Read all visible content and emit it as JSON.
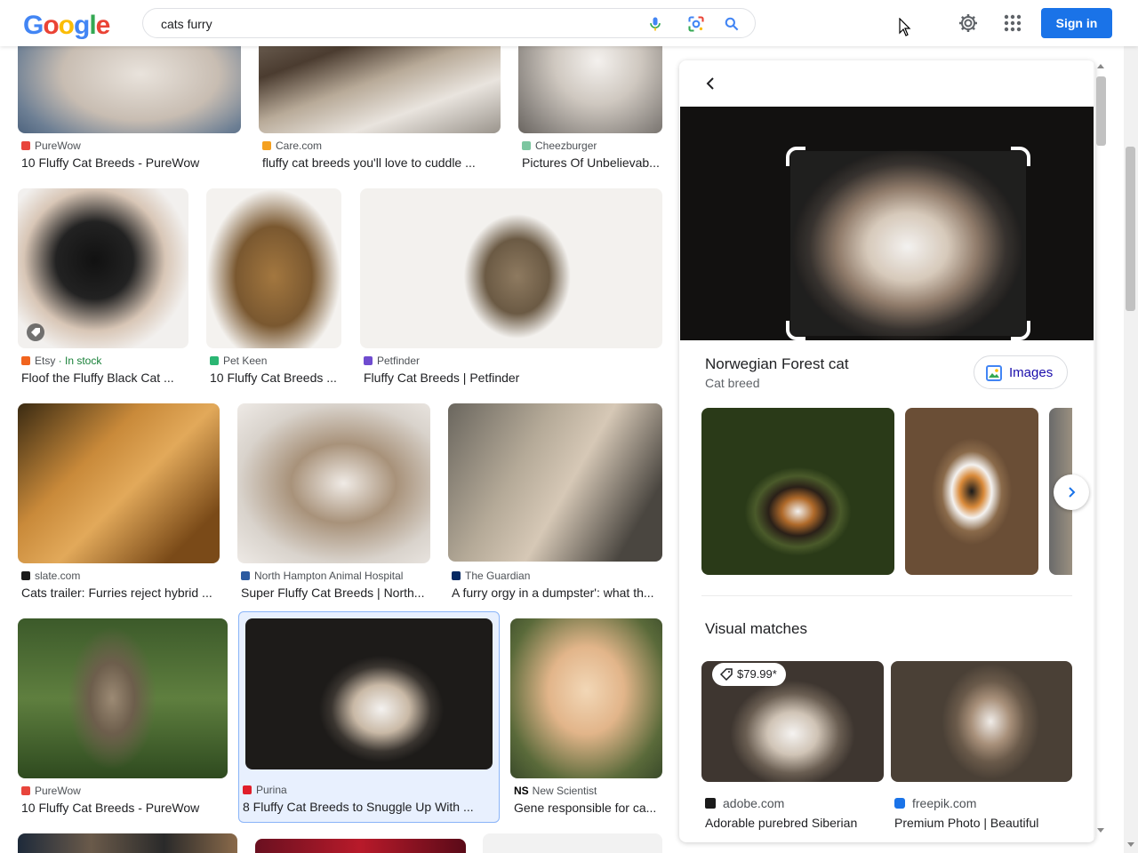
{
  "header": {
    "logo": [
      "G",
      "o",
      "o",
      "g",
      "l",
      "e"
    ],
    "logo_colors": [
      "#4285F4",
      "#EA4335",
      "#FBBC05",
      "#4285F4",
      "#34A853",
      "#EA4335"
    ],
    "search_value": "cats furry",
    "sign_in": "Sign in"
  },
  "results": [
    {
      "source": "PureWow",
      "title": "10 Fluffy Cat Breeds - PureWow",
      "fav": "#e8453c"
    },
    {
      "source": "Care.com",
      "title": "fluffy cat breeds you'll love to cuddle ...",
      "fav": "#f4a020"
    },
    {
      "source": "Cheezburger",
      "title": "Pictures Of Unbelievab...",
      "fav": "#7cc6a0"
    },
    {
      "source": "Etsy",
      "stock": " · In stock",
      "title": "Floof the Fluffy Black Cat ...",
      "fav": "#f1641e"
    },
    {
      "source": "Pet Keen",
      "title": "10 Fluffy Cat Breeds ...",
      "fav": "#2bb673"
    },
    {
      "source": "Petfinder",
      "title": "Fluffy Cat Breeds | Petfinder",
      "fav": "#6f4ccf"
    },
    {
      "source": "slate.com",
      "title": "Cats trailer: Furries reject hybrid ...",
      "fav": "#1a1a1a"
    },
    {
      "source": "North Hampton Animal Hospital",
      "title": "Super Fluffy Cat Breeds | North...",
      "fav": "#2c5aa0"
    },
    {
      "source": "The Guardian",
      "title": "A furry orgy in a dumpster': what th...",
      "fav": "#052962"
    },
    {
      "source": "PureWow",
      "title": "10 Fluffy Cat Breeds - PureWow",
      "fav": "#e8453c"
    },
    {
      "source": "Purina",
      "title": "8 Fluffy Cat Breeds to Snuggle Up With ...",
      "fav": "#e01e2a"
    },
    {
      "source": "New Scientist",
      "title": "Gene responsible for ca...",
      "fav": "#000000",
      "fav_text": "NS"
    }
  ],
  "panel": {
    "entity_title": "Norwegian Forest cat",
    "entity_subtitle": "Cat breed",
    "images_button": "Images",
    "visual_matches_title": "Visual matches",
    "matches": [
      {
        "price": "$79.99*",
        "source": "adobe.com",
        "title": "Adorable purebred Siberian"
      },
      {
        "source": "freepik.com",
        "title": "Premium Photo | Beautiful"
      }
    ]
  },
  "colors": {
    "accent": "#1a73e8",
    "selected_bg": "#e8f0fe"
  }
}
